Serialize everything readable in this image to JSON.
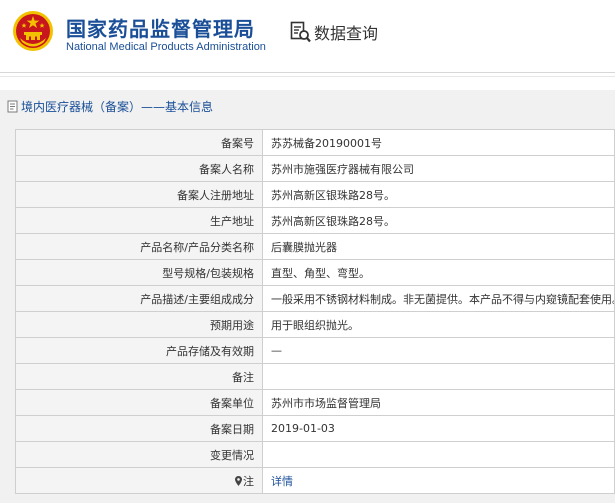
{
  "header": {
    "title_cn": "国家药品监督管理局",
    "title_en": "National Medical Products Administration",
    "query_label": "数据查询"
  },
  "panel": {
    "title": "境内医疗器械（备案）——基本信息"
  },
  "rows": [
    {
      "label": "备案号",
      "value": "苏苏械备20190001号"
    },
    {
      "label": "备案人名称",
      "value": "苏州市施强医疗器械有限公司"
    },
    {
      "label": "备案人注册地址",
      "value": "苏州高新区银珠路28号。"
    },
    {
      "label": "生产地址",
      "value": "苏州高新区银珠路28号。"
    },
    {
      "label": "产品名称/产品分类名称",
      "value": "后囊膜抛光器"
    },
    {
      "label": "型号规格/包装规格",
      "value": "直型、角型、弯型。"
    },
    {
      "label": "产品描述/主要组成成分",
      "value": "一般采用不锈钢材料制成。非无菌提供。本产品不得与内窥镜配套使用。"
    },
    {
      "label": "预期用途",
      "value": "用于眼组织抛光。"
    },
    {
      "label": "产品存储及有效期",
      "value": "—"
    },
    {
      "label": "备注",
      "value": ""
    },
    {
      "label": "备案单位",
      "value": "苏州市市场监督管理局"
    },
    {
      "label": "备案日期",
      "value": "2019-01-03"
    },
    {
      "label": "变更情况",
      "value": ""
    },
    {
      "label": "注",
      "value": "详情"
    }
  ],
  "colors": {
    "brand_blue": "#1a4f98",
    "emblem_red": "#c8161d",
    "emblem_gold": "#f2c200"
  },
  "icons": [
    "national-emblem-icon",
    "magnifier-document-icon",
    "document-icon",
    "location-pin-icon"
  ]
}
